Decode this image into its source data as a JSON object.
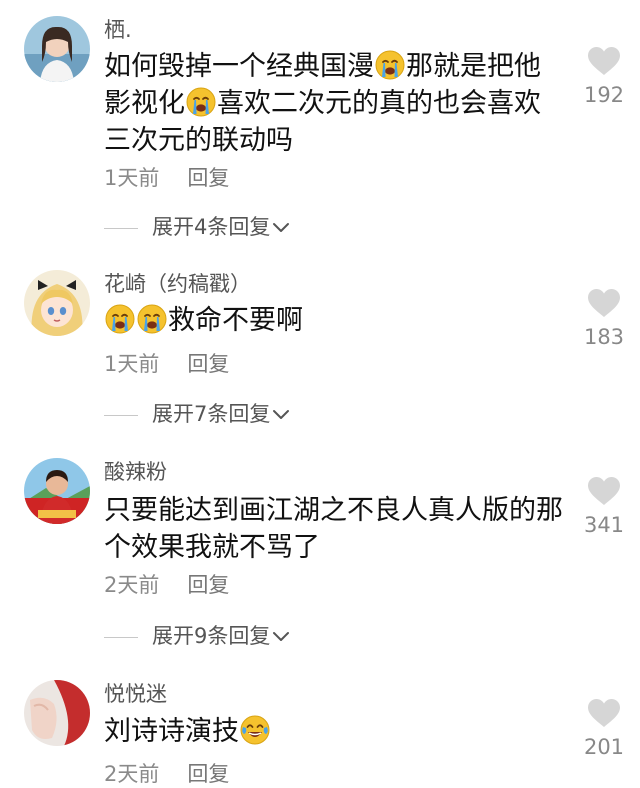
{
  "comments": [
    {
      "username": "栖.",
      "lines": [
        [
          {
            "t": "text",
            "v": "如何毁掉一个经典国漫"
          },
          {
            "t": "emoji",
            "v": "loudly-crying-face"
          },
          {
            "t": "text",
            "v": "那就是把他"
          }
        ],
        [
          {
            "t": "text",
            "v": "影视化"
          },
          {
            "t": "emoji",
            "v": "loudly-crying-face"
          },
          {
            "t": "text",
            "v": "喜欢二次元的真的也会喜欢"
          }
        ],
        [
          {
            "t": "text",
            "v": "三次元的联动吗"
          }
        ]
      ],
      "time": "1天前",
      "reply": "回复",
      "likes": "192",
      "expand": "展开4条回复"
    },
    {
      "username": "花崎（约稿戳）",
      "lines": [
        [
          {
            "t": "emoji",
            "v": "loudly-crying-face"
          },
          {
            "t": "emoji",
            "v": "loudly-crying-face"
          },
          {
            "t": "text",
            "v": "救命不要啊"
          }
        ]
      ],
      "time": "1天前",
      "reply": "回复",
      "likes": "183",
      "expand": "展开7条回复"
    },
    {
      "username": "酸辣粉",
      "lines": [
        [
          {
            "t": "text",
            "v": "只要能达到画江湖之不良人真人版的那"
          }
        ],
        [
          {
            "t": "text",
            "v": "个效果我就不骂了"
          }
        ]
      ],
      "time": "2天前",
      "reply": "回复",
      "likes": "341",
      "expand": "展开9条回复"
    },
    {
      "username": "悦悦迷",
      "lines": [
        [
          {
            "t": "text",
            "v": "刘诗诗演技"
          },
          {
            "t": "emoji",
            "v": "tears-of-joy-face"
          }
        ]
      ],
      "time": "2天前",
      "reply": "回复",
      "likes": "201",
      "expand": ""
    }
  ],
  "colors": {
    "text": "#111111",
    "username": "#555555",
    "meta": "#8a8a8a",
    "heart": "#d6d6d6",
    "emoji_yellow": "#f5c22e",
    "emoji_tear": "#4aa3e8"
  }
}
